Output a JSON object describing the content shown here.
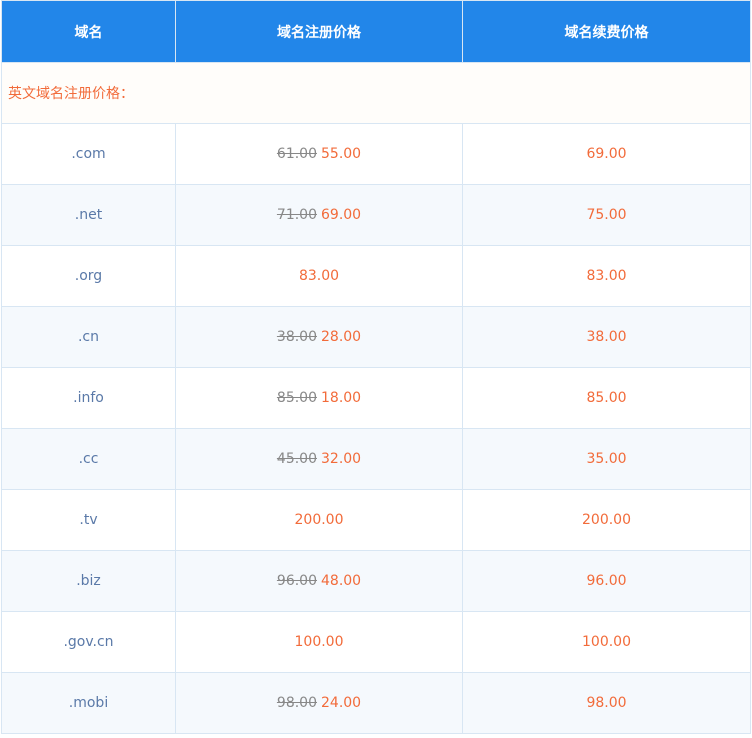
{
  "header": {
    "col_domain": "域名",
    "col_register": "域名注册价格",
    "col_renew": "域名续费价格"
  },
  "section": {
    "label": "英文域名注册价格："
  },
  "rows": [
    {
      "tld": ".com",
      "old": "61.00",
      "price": "55.00",
      "renew": "69.00"
    },
    {
      "tld": ".net",
      "old": "71.00",
      "price": "69.00",
      "renew": "75.00"
    },
    {
      "tld": ".org",
      "old": "",
      "price": "83.00",
      "renew": "83.00"
    },
    {
      "tld": ".cn",
      "old": "38.00",
      "price": "28.00",
      "renew": "38.00"
    },
    {
      "tld": ".info",
      "old": "85.00",
      "price": "18.00",
      "renew": "85.00"
    },
    {
      "tld": ".cc",
      "old": "45.00",
      "price": "32.00",
      "renew": "35.00"
    },
    {
      "tld": ".tv",
      "old": "",
      "price": "200.00",
      "renew": "200.00"
    },
    {
      "tld": ".biz",
      "old": "96.00",
      "price": "48.00",
      "renew": "96.00"
    },
    {
      "tld": ".gov.cn",
      "old": "",
      "price": "100.00",
      "renew": "100.00"
    },
    {
      "tld": ".mobi",
      "old": "98.00",
      "price": "24.00",
      "renew": "98.00"
    }
  ],
  "colors": {
    "header_bg": "#2286e9",
    "price": "#f26b3a",
    "tld": "#5a79a8",
    "old_price": "#888888"
  }
}
